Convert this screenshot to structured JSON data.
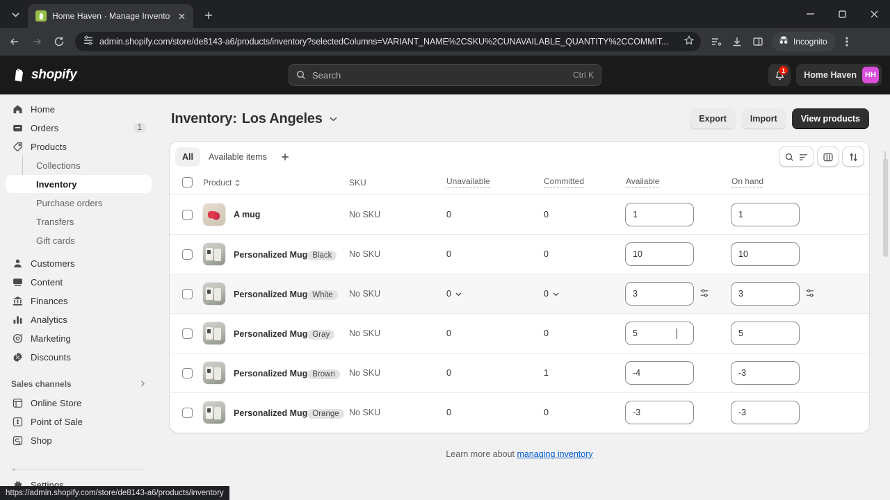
{
  "browser": {
    "tab": {
      "title": "Home Haven · Manage Invento",
      "favicon": "shopify-icon"
    },
    "new_tab_label": "+",
    "url": "admin.shopify.com/store/de8143-a6/products/inventory?selectedColumns=VARIANT_NAME%2CSKU%2CUNAVAILABLE_QUANTITY%2CCOMMIT...",
    "profile_label": "Incognito",
    "status_url": "https://admin.shopify.com/store/de8143-a6/products/inventory"
  },
  "topbar": {
    "brand": "shopify",
    "search": {
      "placeholder": "Search",
      "shortcut": "Ctrl K"
    },
    "notifications_count": "1",
    "store_name": "Home Haven",
    "avatar_initials": "HH"
  },
  "sidebar": {
    "items": [
      {
        "label": "Home",
        "icon": "home-icon"
      },
      {
        "label": "Orders",
        "icon": "orders-icon",
        "count": "1"
      },
      {
        "label": "Products",
        "icon": "tag-icon"
      }
    ],
    "product_subitems": [
      {
        "label": "Collections",
        "active": false
      },
      {
        "label": "Inventory",
        "active": true
      },
      {
        "label": "Purchase orders",
        "active": false
      },
      {
        "label": "Transfers",
        "active": false
      },
      {
        "label": "Gift cards",
        "active": false
      }
    ],
    "items2": [
      {
        "label": "Customers",
        "icon": "customer-icon"
      },
      {
        "label": "Content",
        "icon": "content-icon"
      },
      {
        "label": "Finances",
        "icon": "finances-icon"
      },
      {
        "label": "Analytics",
        "icon": "analytics-icon"
      },
      {
        "label": "Marketing",
        "icon": "marketing-icon"
      },
      {
        "label": "Discounts",
        "icon": "discounts-icon"
      }
    ],
    "sales_channels_label": "Sales channels",
    "channels": [
      {
        "label": "Online Store",
        "icon": "online-store-icon"
      },
      {
        "label": "Point of Sale",
        "icon": "point-of-sale-icon"
      },
      {
        "label": "Shop",
        "icon": "shop-icon"
      }
    ],
    "settings_label": "Settings"
  },
  "page": {
    "title": "Inventory:",
    "location": "Los Angeles",
    "actions": {
      "export": "Export",
      "import": "Import",
      "view_products": "View products"
    }
  },
  "views": {
    "tabs": [
      {
        "label": "All",
        "selected": true
      },
      {
        "label": "Available items",
        "selected": false
      }
    ],
    "add_label": "+"
  },
  "table": {
    "columns": [
      {
        "label": "Product",
        "sortable": true,
        "tooltip": false
      },
      {
        "label": "SKU",
        "sortable": false,
        "tooltip": false
      },
      {
        "label": "Unavailable",
        "sortable": false,
        "tooltip": true
      },
      {
        "label": "Committed",
        "sortable": false,
        "tooltip": true
      },
      {
        "label": "Available",
        "sortable": false,
        "tooltip": true
      },
      {
        "label": "On hand",
        "sortable": false,
        "tooltip": true
      }
    ],
    "rows": [
      {
        "product": "A mug",
        "variant": "",
        "thumb": "floral",
        "sku": "No SKU",
        "unavailable": "0",
        "committed": "0",
        "available": "1",
        "on_hand": "1",
        "hover": false
      },
      {
        "product": "Personalized Mug",
        "variant": "Black",
        "thumb": "mug",
        "sku": "No SKU",
        "unavailable": "0",
        "committed": "0",
        "available": "10",
        "on_hand": "10",
        "hover": false
      },
      {
        "product": "Personalized Mug",
        "variant": "White",
        "thumb": "mug",
        "sku": "No SKU",
        "unavailable": "0",
        "committed": "0",
        "available": "3",
        "on_hand": "3",
        "hover": true
      },
      {
        "product": "Personalized Mug",
        "variant": "Gray",
        "thumb": "mug",
        "sku": "No SKU",
        "unavailable": "0",
        "committed": "0",
        "available": "5",
        "on_hand": "5",
        "hover": false
      },
      {
        "product": "Personalized Mug",
        "variant": "Brown",
        "thumb": "mug",
        "sku": "No SKU",
        "unavailable": "0",
        "committed": "1",
        "available": "-4",
        "on_hand": "-3",
        "hover": false
      },
      {
        "product": "Personalized Mug",
        "variant": "Orange",
        "thumb": "mug",
        "sku": "No SKU",
        "unavailable": "0",
        "committed": "0",
        "available": "-3",
        "on_hand": "-3",
        "hover": false
      }
    ]
  },
  "footer": {
    "text": "Learn more about ",
    "link": "managing inventory"
  },
  "colors": {
    "accent_link": "#005bd3",
    "primary_button_bg": "#303030",
    "avatar_bg": "#d94edb",
    "badge_red": "#e51c00",
    "app_bg": "#f1f1f1"
  }
}
